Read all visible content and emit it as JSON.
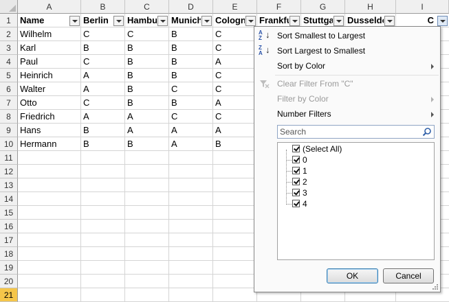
{
  "columns": [
    "A",
    "B",
    "C",
    "D",
    "E",
    "F",
    "G",
    "H",
    "I"
  ],
  "rows": [
    "1",
    "2",
    "3",
    "4",
    "5",
    "6",
    "7",
    "8",
    "9",
    "10",
    "11",
    "12",
    "13",
    "14",
    "15",
    "16",
    "17",
    "18",
    "19",
    "20",
    "21"
  ],
  "headers": [
    "Name",
    "Berlin",
    "Hambu",
    "Munich",
    "Cologn",
    "Frankfu",
    "Stuttga",
    "Dusseldo",
    "C"
  ],
  "data": [
    [
      "Wilhelm",
      "C",
      "C",
      "B",
      "C"
    ],
    [
      "Karl",
      "B",
      "B",
      "B",
      "C"
    ],
    [
      "Paul",
      "C",
      "B",
      "B",
      "A"
    ],
    [
      "Heinrich",
      "A",
      "B",
      "B",
      "C"
    ],
    [
      "Walter",
      "A",
      "B",
      "C",
      "C"
    ],
    [
      "Otto",
      "C",
      "B",
      "B",
      "A"
    ],
    [
      "Friedrich",
      "A",
      "A",
      "C",
      "C"
    ],
    [
      "Hans",
      "B",
      "A",
      "A",
      "A"
    ],
    [
      "Hermann",
      "B",
      "B",
      "A",
      "B"
    ]
  ],
  "menu": {
    "sort_asc": "Sort Smallest to Largest",
    "sort_desc": "Sort Largest to Smallest",
    "sort_color": "Sort by Color",
    "clear_filter": "Clear Filter From \"C\"",
    "filter_color": "Filter by Color",
    "number_filters": "Number Filters",
    "search_placeholder": "Search",
    "select_all": "(Select All)",
    "values": [
      "0",
      "1",
      "2",
      "3",
      "4"
    ],
    "ok": "OK",
    "cancel": "Cancel"
  },
  "icons": {
    "sort_asc_letters": [
      "A",
      "Z"
    ],
    "sort_desc_letters": [
      "Z",
      "A"
    ]
  },
  "colors": {
    "annotation_arrow": "#1f1fd8",
    "selected_row": "#f5c64a"
  }
}
